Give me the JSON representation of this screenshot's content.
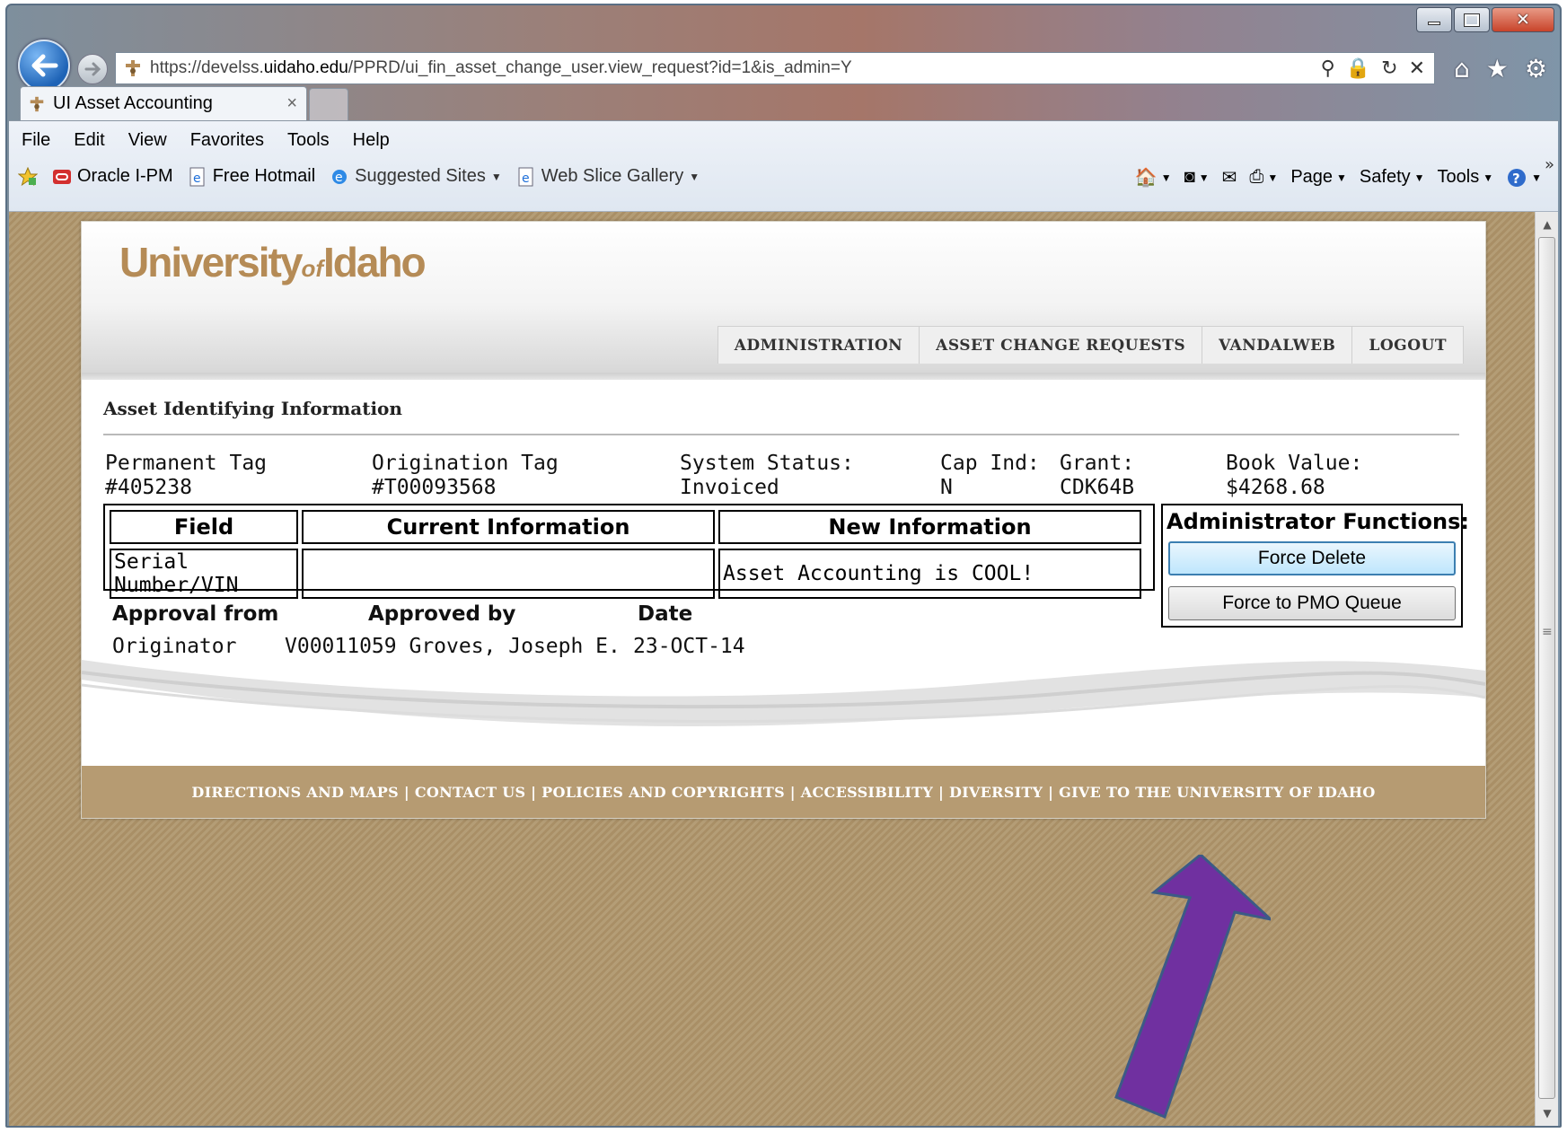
{
  "browser": {
    "url_prefix": "https://develss.",
    "url_host": "uidaho.edu",
    "url_path": "/PPRD/ui_fin_asset_change_user.view_request?id=1&is_admin=Y",
    "tab_title": "UI Asset Accounting",
    "tab_close": "×",
    "menu": [
      "File",
      "Edit",
      "View",
      "Favorites",
      "Tools",
      "Help"
    ],
    "favorites": [
      "Oracle I-PM",
      "Free Hotmail",
      "Suggested Sites",
      "Web Slice Gallery"
    ],
    "commands": [
      "Page",
      "Safety",
      "Tools"
    ],
    "address_icons": [
      "search-icon",
      "lock-icon",
      "refresh-icon",
      "stop-icon"
    ],
    "right_icons": [
      "home-icon",
      "favorites-star-icon",
      "settings-gear-icon"
    ],
    "window_close": "✕"
  },
  "site": {
    "logo_left": "University",
    "logo_of": "of",
    "logo_right": "Idaho",
    "nav": [
      "ADMINISTRATION",
      "ASSET CHANGE REQUESTS",
      "VANDALWEB",
      "LOGOUT"
    ]
  },
  "asset": {
    "section_title": "Asset Identifying Information",
    "permanent_tag_label": "Permanent Tag",
    "permanent_tag_value": "#405238",
    "origination_tag_label": "Origination Tag",
    "origination_tag_value": "#T00093568",
    "system_status_label": "System Status:",
    "system_status_value": "Invoiced",
    "cap_ind_label": "Cap Ind:",
    "cap_ind_value": "N",
    "grant_label": "Grant:",
    "grant_value": "CDK64B",
    "book_value_label": "Book Value:",
    "book_value_value": "$4268.68"
  },
  "change_table": {
    "headers": [
      "Field",
      "Current Information",
      "New Information"
    ],
    "rows": [
      {
        "field": "Serial Number/VIN",
        "current": "",
        "new": "Asset Accounting is COOL!"
      }
    ]
  },
  "admin": {
    "title": "Administrator Functions:",
    "force_delete": "Force Delete",
    "force_pmo": "Force to PMO Queue"
  },
  "approval": {
    "headers": [
      "Approval from",
      "Approved by",
      "Date"
    ],
    "row": {
      "from": "Originator",
      "by": "V00011059 Groves, Joseph E.",
      "date": "23-OCT-14"
    }
  },
  "footer": {
    "text": "DIRECTIONS AND MAPS | CONTACT US | POLICIES AND COPYRIGHTS | ACCESSIBILITY | DIVERSITY | GIVE TO THE UNIVERSITY OF IDAHO"
  },
  "colors": {
    "brand_gold": "#b58b56",
    "footer_bg": "#b69b72",
    "annotation_arrow": "#7030a0"
  }
}
